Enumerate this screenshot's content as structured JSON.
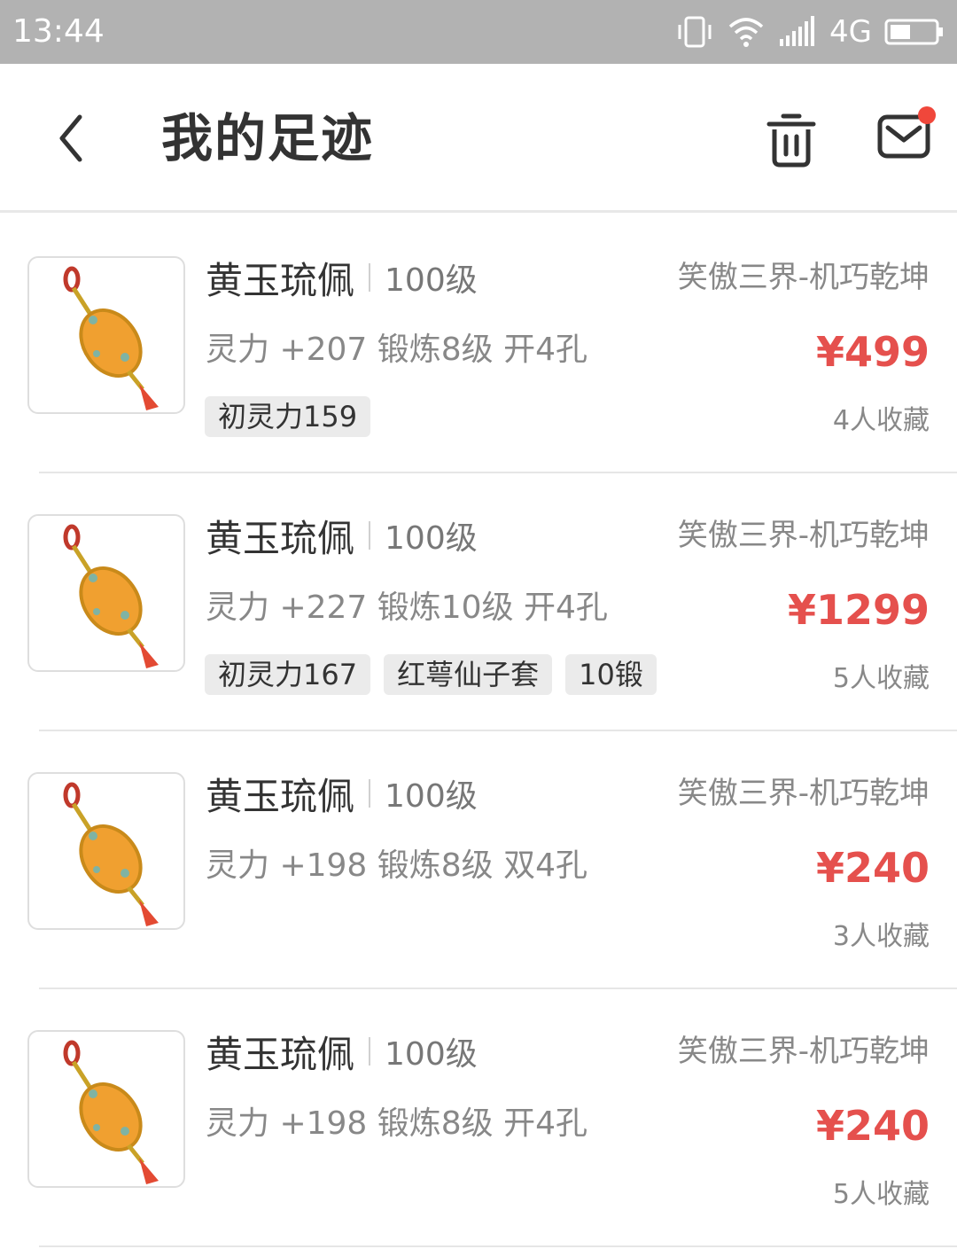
{
  "status_bar": {
    "time": "13:44",
    "network": "4G",
    "icons": [
      "vibrate-icon",
      "wifi-icon",
      "signal-icon",
      "battery-icon"
    ]
  },
  "header": {
    "title": "我的足迹",
    "back_icon": "chevron-left-icon",
    "trash_icon": "trash-icon",
    "mail_icon": "mail-icon",
    "has_unread_dot": true
  },
  "colors": {
    "price": "#e5504d",
    "status_bar": "#b2b2b2",
    "unread_dot": "#f0473b"
  },
  "items": [
    {
      "name": "黄玉琉佩",
      "level": "100级",
      "attrs": "灵力 +207 锻炼8级 开4孔",
      "server": "笑傲三界-机巧乾坤",
      "price": "¥499",
      "favs": "4人收藏",
      "tags": [
        "初灵力159"
      ]
    },
    {
      "name": "黄玉琉佩",
      "level": "100级",
      "attrs": "灵力 +227 锻炼10级 开4孔",
      "server": "笑傲三界-机巧乾坤",
      "price": "¥1299",
      "favs": "5人收藏",
      "tags": [
        "初灵力167",
        "红萼仙子套",
        "10锻"
      ]
    },
    {
      "name": "黄玉琉佩",
      "level": "100级",
      "attrs": "灵力 +198 锻炼8级 双4孔",
      "server": "笑傲三界-机巧乾坤",
      "price": "¥240",
      "favs": "3人收藏",
      "tags": []
    },
    {
      "name": "黄玉琉佩",
      "level": "100级",
      "attrs": "灵力 +198 锻炼8级 开4孔",
      "server": "笑傲三界-机巧乾坤",
      "price": "¥240",
      "favs": "5人收藏",
      "tags": []
    }
  ]
}
